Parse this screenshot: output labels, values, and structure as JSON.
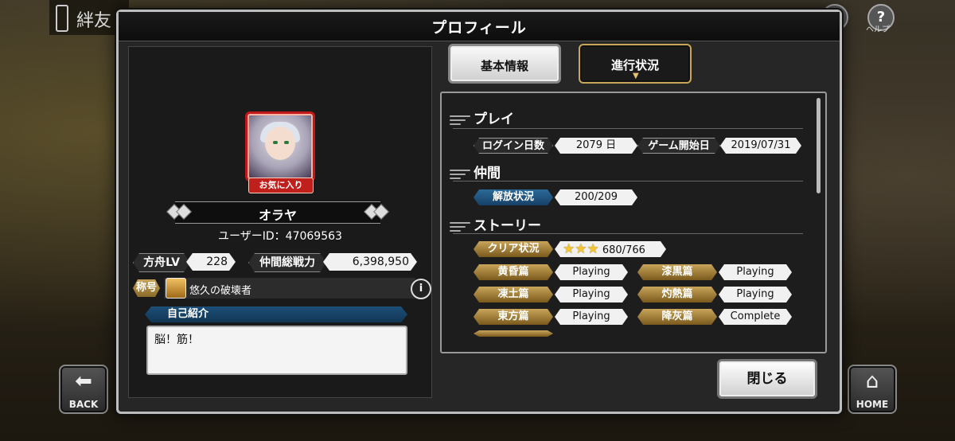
{
  "background": {
    "top_left_title": "絆友",
    "right_icon_label": "ヘルプ",
    "back_label": "BACK",
    "home_label": "HOME"
  },
  "modal": {
    "title": "プロフィール",
    "close_label": "閉じる"
  },
  "profile": {
    "favorite_badge": "お気に入り",
    "name": "オラヤ",
    "user_id": "ユーザーID：47069563",
    "ark_lv_label": "方舟LV",
    "ark_lv_value": "228",
    "total_power_label": "仲間総戦力",
    "total_power_value": "6,398,950",
    "title_label": "称号",
    "title_value": "悠久の破壊者",
    "intro_header": "自己紹介",
    "intro_text": "脳！筋！"
  },
  "tabs": [
    {
      "label": "基本情報",
      "active": false
    },
    {
      "label": "進行状況",
      "active": true
    }
  ],
  "progress": {
    "play": {
      "heading": "プレイ",
      "login_days_label": "ログイン日数",
      "login_days_value": "2079 日",
      "start_date_label": "ゲーム開始日",
      "start_date_value": "2019/07/31"
    },
    "companions": {
      "heading": "仲間",
      "unlock_label": "解放状況",
      "unlock_value": "200/209"
    },
    "story": {
      "heading": "ストーリー",
      "clear_label": "クリア状況",
      "clear_stars": 3,
      "clear_value": "680/766",
      "chapters": [
        {
          "name": "黄昏篇",
          "status": "Playing"
        },
        {
          "name": "漆黒篇",
          "status": "Playing"
        },
        {
          "name": "凍土篇",
          "status": "Playing"
        },
        {
          "name": "灼熱篇",
          "status": "Playing"
        },
        {
          "name": "東方篇",
          "status": "Playing"
        },
        {
          "name": "降灰篇",
          "status": "Complete"
        }
      ]
    }
  },
  "colors": {
    "gold": "#c9a55a",
    "blue": "#1c4f78",
    "favorite_red": "#c0201c"
  }
}
